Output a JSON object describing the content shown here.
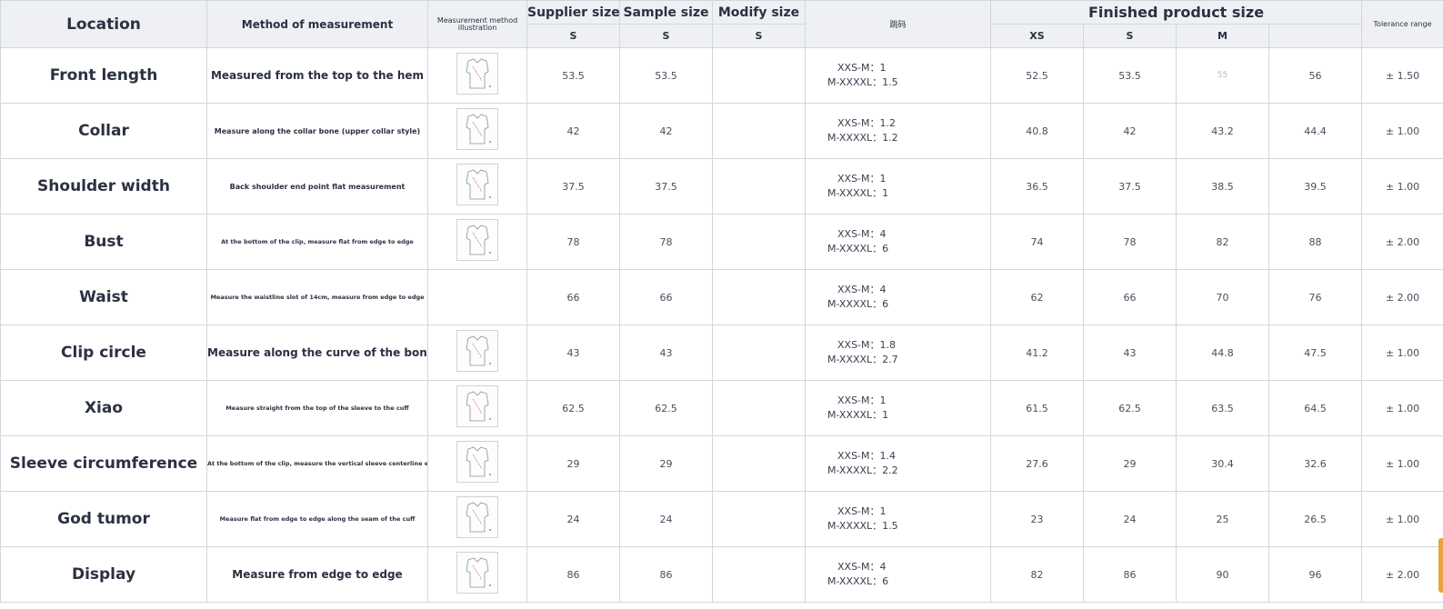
{
  "headers": {
    "location": "Location",
    "method": "Method of measurement",
    "illustration": "Measurement method illustration",
    "supplier": "Supplier size",
    "sample": "Sample size",
    "modify": "Modify size",
    "grading": "跳码",
    "finished": "Finished product size",
    "tolerance": "Tolerance range",
    "sub_supplier": "S",
    "sub_sample": "S",
    "sub_modify": "S",
    "sub_xs": "XS",
    "sub_s": "S",
    "sub_m": "M",
    "sub_l": ""
  },
  "rows": [
    {
      "location": "Front length",
      "method": "Measured from the top to the hem",
      "supplier": "53.5",
      "sample": "53.5",
      "modify": "",
      "grade1": "XXS-M：1",
      "grade2": "M-XXXXL：1.5",
      "xs": "52.5",
      "s": "53.5",
      "m": "55",
      "l": "56",
      "tol": "± 1.50",
      "icon": "front-length-illustration-icon"
    },
    {
      "location": "Collar",
      "method": "Measure along the collar bone (upper collar style)",
      "supplier": "42",
      "sample": "42",
      "modify": "",
      "grade1": "XXS-M：1.2",
      "grade2": "M-XXXXL：1.2",
      "xs": "40.8",
      "s": "42",
      "m": "43.2",
      "l": "44.4",
      "tol": "± 1.00",
      "icon": "collar-illustration-icon"
    },
    {
      "location": "Shoulder width",
      "method": "Back shoulder end point flat measurement",
      "supplier": "37.5",
      "sample": "37.5",
      "modify": "",
      "grade1": "XXS-M：1",
      "grade2": "M-XXXXL：1",
      "xs": "36.5",
      "s": "37.5",
      "m": "38.5",
      "l": "39.5",
      "tol": "± 1.00",
      "icon": "shoulder-illustration-icon"
    },
    {
      "location": "Bust",
      "method": "At the bottom of the clip, measure flat from edge to edge",
      "supplier": "78",
      "sample": "78",
      "modify": "",
      "grade1": "XXS-M：4",
      "grade2": "M-XXXXL：6",
      "xs": "74",
      "s": "78",
      "m": "82",
      "l": "88",
      "tol": "± 2.00",
      "icon": "bust-illustration-icon"
    },
    {
      "location": "Waist",
      "method": "Measure the waistline slot of 14cm, measure from edge to edge",
      "supplier": "66",
      "sample": "66",
      "modify": "",
      "grade1": "XXS-M：4",
      "grade2": "M-XXXXL：6",
      "xs": "62",
      "s": "66",
      "m": "70",
      "l": "76",
      "tol": "± 2.00",
      "icon": ""
    },
    {
      "location": "Clip circle",
      "method": "Measure along the curve of the bone",
      "supplier": "43",
      "sample": "43",
      "modify": "",
      "grade1": "XXS-M：1.8",
      "grade2": "M-XXXXL：2.7",
      "xs": "41.2",
      "s": "43",
      "m": "44.8",
      "l": "47.5",
      "tol": "± 1.00",
      "icon": "clip-circle-illustration-icon"
    },
    {
      "location": "Xiao",
      "method": "Measure straight from the top of the sleeve to the cuff",
      "supplier": "62.5",
      "sample": "62.5",
      "modify": "",
      "grade1": "XXS-M：1",
      "grade2": "M-XXXXL：1",
      "xs": "61.5",
      "s": "62.5",
      "m": "63.5",
      "l": "64.5",
      "tol": "± 1.00",
      "icon": "sleeve-length-illustration-icon"
    },
    {
      "location": "Sleeve circumference",
      "method": "At the bottom of the clip, measure the vertical sleeve centerline edge to edge",
      "supplier": "29",
      "sample": "29",
      "modify": "",
      "grade1": "XXS-M：1.4",
      "grade2": "M-XXXXL：2.2",
      "xs": "27.6",
      "s": "29",
      "m": "30.4",
      "l": "32.6",
      "tol": "± 1.00",
      "icon": "sleeve-circumference-illustration-icon"
    },
    {
      "location": "God tumor",
      "method": "Measure flat from edge to edge along the seam of the cuff",
      "supplier": "24",
      "sample": "24",
      "modify": "",
      "grade1": "XXS-M：1",
      "grade2": "M-XXXXL：1.5",
      "xs": "23",
      "s": "24",
      "m": "25",
      "l": "26.5",
      "tol": "± 1.00",
      "icon": "cuff-illustration-icon"
    },
    {
      "location": "Display",
      "method": "Measure from edge to edge",
      "supplier": "86",
      "sample": "86",
      "modify": "",
      "grade1": "XXS-M：4",
      "grade2": "M-XXXXL：6",
      "xs": "82",
      "s": "86",
      "m": "90",
      "l": "96",
      "tol": "± 2.00",
      "icon": "display-illustration-icon"
    }
  ]
}
